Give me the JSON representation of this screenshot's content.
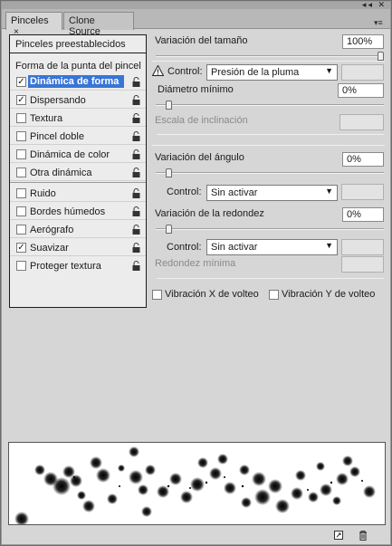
{
  "tabs": [
    {
      "label": "Pinceles",
      "close": "×"
    },
    {
      "label": "Clone Source"
    }
  ],
  "window_controls": "◂◂ ✕",
  "panel_menu_glyph": "▾≡",
  "left_list": {
    "presets": "Pinceles preestablecidos",
    "shape": "Forma de la punta del pincel",
    "items": [
      {
        "label": "Dinámica de forma",
        "checked": true,
        "selected": true
      },
      {
        "label": "Dispersando",
        "checked": true
      },
      {
        "label": "Textura",
        "checked": false
      },
      {
        "label": "Pincel doble",
        "checked": false
      },
      {
        "label": "Dinámica de color",
        "checked": false
      },
      {
        "label": "Otra dinámica",
        "checked": false
      },
      {
        "label": "Ruido",
        "checked": false
      },
      {
        "label": "Bordes húmedos",
        "checked": false
      },
      {
        "label": "Aerógrafo",
        "checked": false
      },
      {
        "label": "Suavizar",
        "checked": true
      },
      {
        "label": "Proteger textura",
        "checked": false
      }
    ],
    "check_glyph": "✓"
  },
  "size": {
    "label": "Variación del tamaño",
    "value": "100%",
    "control_label": "Control:",
    "control_value": "Presión de la pluma",
    "warning_glyph": "!",
    "min_diameter_label": "Diámetro mínimo",
    "min_diameter_value": "0%",
    "tilt_label": "Escala de inclinación"
  },
  "angle": {
    "label": "Variación del ángulo",
    "value": "0%",
    "control_label": "Control:",
    "control_value": "Sin activar"
  },
  "roundness": {
    "label": "Variación de la redondez",
    "value": "0%",
    "control_label": "Control:",
    "control_value": "Sin activar",
    "min_label": "Redondez mínima"
  },
  "flip": {
    "x_label": "Vibración X de volteo",
    "y_label": "Vibración Y de volteo"
  },
  "dropdown_glyph": "▼"
}
